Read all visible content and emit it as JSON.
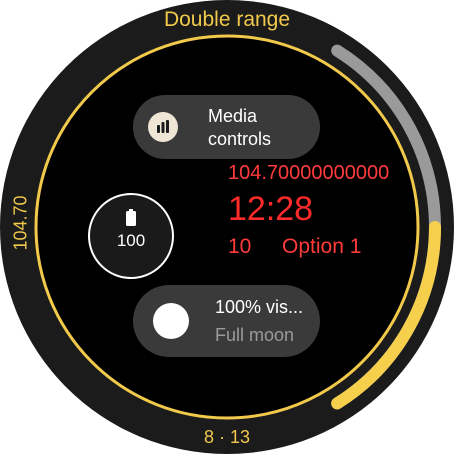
{
  "complication_title": "Double range",
  "left_value": "104.70",
  "bottom_date": "8 · 13",
  "media_chip": {
    "label": "Media controls",
    "icon": "bars-icon"
  },
  "battery": {
    "value": "100",
    "icon": "battery-icon",
    "level": 1.0
  },
  "red_data": {
    "long_value": "104.70000000000",
    "time": "12:28",
    "count": "10",
    "option": "Option 1"
  },
  "moon_chip": {
    "title": "100% vis...",
    "subtitle": "Full moon",
    "icon": "moon-icon"
  },
  "range_arc": {
    "track_fraction": 1.0,
    "fill_fraction": 0.5
  },
  "colors": {
    "accent": "#f1c94b",
    "ring_gray": "#9a9a9a",
    "red": "#ff3b3b",
    "chip": "#3a3a3a"
  }
}
